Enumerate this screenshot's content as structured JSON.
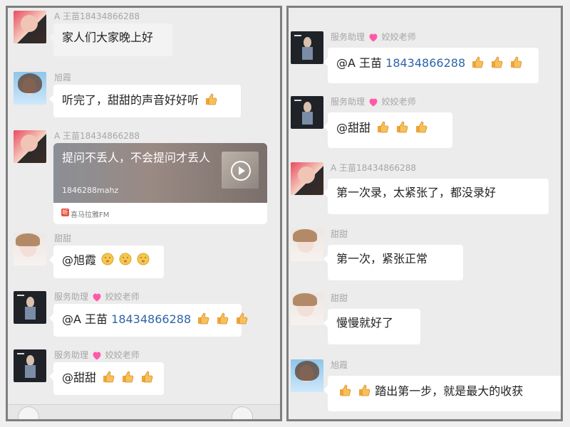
{
  "left_panel": {
    "messages": [
      {
        "name": "A 王苗18434866288",
        "text": "家人们大家晚上好",
        "type": "plain"
      },
      {
        "name": "旭霞",
        "text": "听完了，甜甜的声音好好听",
        "type": "thumb1"
      },
      {
        "name": "A 王苗18434866288",
        "share_title": "提问不丢人，不会提问才丢人",
        "share_sub": "1846288mahz",
        "share_source": "喜马拉雅FM",
        "type": "share"
      },
      {
        "name": "甜甜",
        "text": "@旭霞",
        "type": "kiss3"
      },
      {
        "name_prefix": "服务助理",
        "name_suffix": "姣姣老师",
        "mention": "@A 王苗",
        "phone": "18434866288",
        "type": "thumb3"
      },
      {
        "name_prefix": "服务助理",
        "name_suffix": "姣姣老师",
        "text": "@甜甜",
        "type": "thumb3"
      }
    ]
  },
  "right_panel": {
    "messages": [
      {
        "name_prefix": "服务助理",
        "name_suffix": "姣姣老师",
        "mention": "@A 王苗",
        "phone": "18434866288",
        "type": "thumb3"
      },
      {
        "name_prefix": "服务助理",
        "name_suffix": "姣姣老师",
        "text": "@甜甜",
        "type": "thumb3"
      },
      {
        "name": "A 王苗18434866288",
        "text": "第一次录，太紧张了，都没录好",
        "type": "plain"
      },
      {
        "name": "甜甜",
        "text": "第一次，紧张正常",
        "type": "plain"
      },
      {
        "name": "甜甜",
        "text": "慢慢就好了",
        "type": "plain"
      },
      {
        "name": "旭霞",
        "text": "踏出第一步，就是最大的收获",
        "type": "thumb2prefix"
      }
    ]
  },
  "colors": {
    "background": "#ececec",
    "bubble": "#ffffff",
    "name": "#a6a6a6",
    "phone": "#2e64a8",
    "heart": "#ff5aa8"
  },
  "icons": {
    "thumbs": "thumbs-up-icon",
    "kiss": "kiss-emoji-icon",
    "heart": "heart-icon",
    "play": "play-icon",
    "source": "ximalaya-logo-icon"
  }
}
